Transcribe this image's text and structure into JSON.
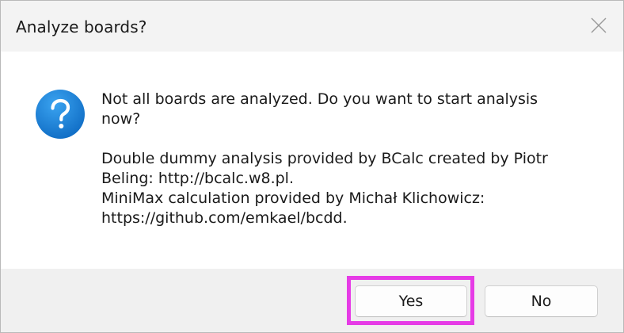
{
  "dialog": {
    "title": "Analyze boards?",
    "message": "Not all boards are analyzed. Do you want to start analysis\nnow?\n\nDouble dummy analysis provided by BCalc created by Piotr\nBeling: http://bcalc.w8.pl.\nMiniMax calculation provided by Michał Klichowicz:\nhttps://github.com/emkael/bcdd.",
    "icon": "question-icon",
    "close_icon": "close-icon"
  },
  "buttons": {
    "yes_label": "Yes",
    "no_label": "No"
  },
  "colors": {
    "question_icon_bg": "#1b7fd6",
    "highlight": "#e63be6",
    "footer_bg": "#f0f0f0",
    "titlebar_bg": "#f3f3f3"
  }
}
